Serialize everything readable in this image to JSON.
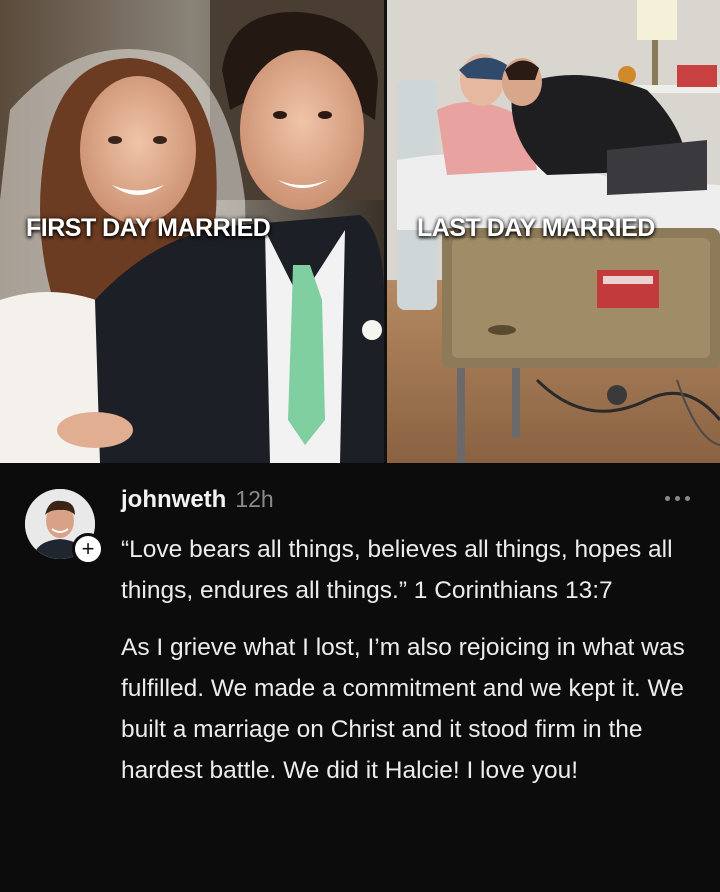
{
  "collage": {
    "left_caption": "FIRST DAY MARRIED",
    "right_caption": "LAST DAY MARRIED"
  },
  "post": {
    "username": "johnweth",
    "timestamp": "12h",
    "follow_symbol": "+",
    "quote": "“Love bears all things, believes all things, hopes all things, endures all things.” 1 Corinthians 13:7",
    "message": "As I grieve what I lost, I’m also rejoicing in what was fulfilled. We made a commitment and we kept it. We built a marriage on Christ and it stood firm in the hardest battle. We did it Halcie! I love you!"
  },
  "icons": {
    "more": "more-horizontal-icon",
    "follow": "plus-icon"
  },
  "colors": {
    "background": "#0c0c0c",
    "text_primary": "#ececec",
    "text_secondary": "#8a8a8a",
    "caption_text": "#ffffff"
  }
}
